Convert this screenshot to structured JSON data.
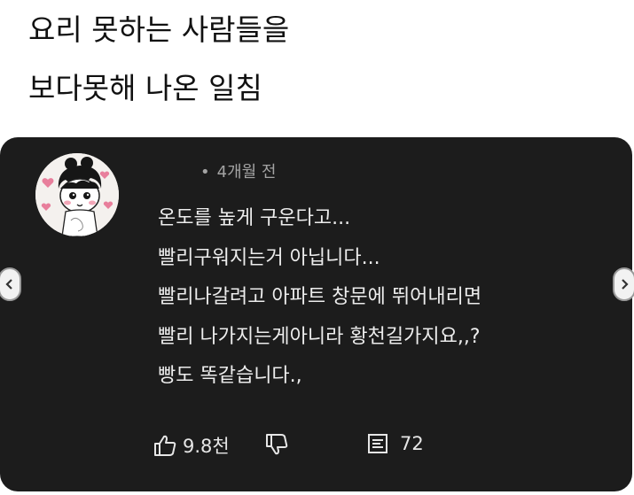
{
  "headline": {
    "line1": "요리 못하는 사람들을",
    "line2": "보다못해 나온 일침"
  },
  "comment": {
    "time_dot": "•",
    "time": "4개월 전",
    "lines": [
      "온도를 높게 구운다고...",
      "빨리구워지는거 아닙니다...",
      "빨리나갈려고 아파트 창문에 뛰어내리면",
      "빨리 나가지는게아니라 황천길가지요,,?",
      "빵도 똑같습니다.,"
    ],
    "likes": "9.8천",
    "replies": "72"
  },
  "icons": {
    "like": "thumbs-up-icon",
    "dislike": "thumbs-down-icon",
    "reply": "reply-icon",
    "prev": "chevron-left-icon",
    "next": "chevron-right-icon"
  },
  "colors": {
    "card_bg": "#1c1c1c",
    "text": "#ededed",
    "meta": "#a3a3a3",
    "page_bg": "#ffffff"
  }
}
